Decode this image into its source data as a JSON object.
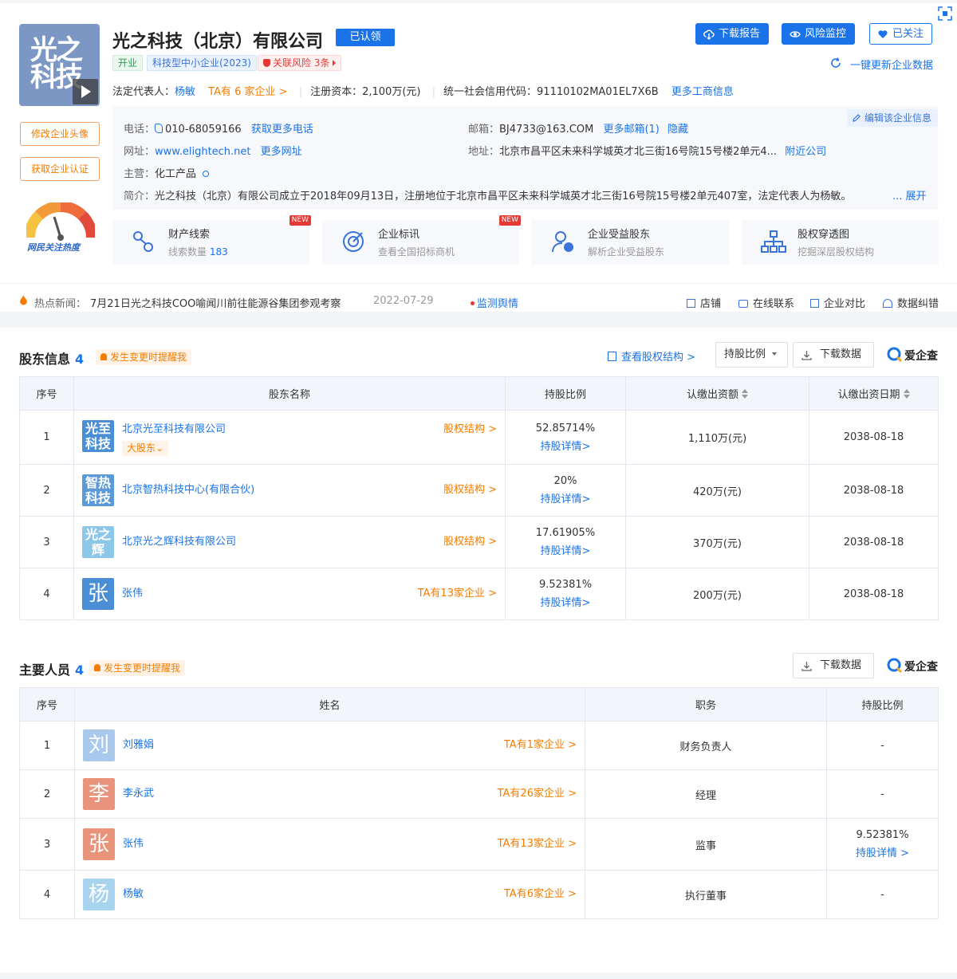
{
  "company": {
    "logo_text": "光之科技",
    "name": "光之科技（北京）有限公司",
    "claimed": "已认领",
    "tags": {
      "status": "开业",
      "sme": "科技型中小企业(2023)",
      "risk": "关联风险 3条"
    },
    "buttons": {
      "download": "下载报告",
      "monitor": "风险监控",
      "follow": "已关注"
    },
    "refresh": "一键更新企业数据",
    "legal_rep_label": "法定代表人：",
    "legal_rep": "杨敏",
    "legal_rep_companies": "TA有 6 家企业 >",
    "capital_label": "注册资本：",
    "capital": "2,100万(元)",
    "credit_code_label": "统一社会信用代码：",
    "credit_code": "91110102MA01EL7X6B",
    "more_business_info": "更多工商信息",
    "side_buttons": {
      "edit_avatar": "修改企业头像",
      "get_cert": "获取企业认证"
    },
    "heat_label": "网民关注热度"
  },
  "info": {
    "edit": "编辑该企业信息",
    "phone_label": "电话：",
    "phone": "010-68059166",
    "more_phone": "获取更多电话",
    "email_label": "邮箱：",
    "email": "BJ4733@163.COM",
    "more_email": "更多邮箱(1)",
    "hide": "隐藏",
    "website_label": "网址：",
    "website": "www.elightech.net",
    "more_website": "更多网址",
    "address_label": "地址：",
    "address": "北京市昌平区未来科学城英才北三街16号院15号楼2单元4...",
    "nearby": "附近公司",
    "business_label": "主营：",
    "business": "化工产品",
    "intro_label": "简介：",
    "intro": "光之科技（北京）有限公司成立于2018年09月13日，注册地位于北京市昌平区未来科学城英才北三街16号院15号楼2单元407室，法定代表人为杨敏。",
    "expand": "... 展开"
  },
  "features": [
    {
      "title": "财产线索",
      "sub_label": "线索数量",
      "sub_value": "183",
      "badge": "NEW"
    },
    {
      "title": "企业标讯",
      "sub_label": "查看全国招标商机",
      "sub_value": "",
      "badge": "NEW"
    },
    {
      "title": "企业受益股东",
      "sub_label": "解析企业受益股东",
      "sub_value": "",
      "badge": ""
    },
    {
      "title": "股权穿透图",
      "sub_label": "挖掘深层股权结构",
      "sub_value": "",
      "badge": ""
    }
  ],
  "news": {
    "label": "热点新闻：",
    "text": "7月21日光之科技COO喻闻川前往能源谷集团参观考察",
    "date": "2022-07-29",
    "monitor": "监测舆情",
    "links": [
      "店铺",
      "在线联系",
      "企业对比",
      "数据纠错"
    ]
  },
  "shareholders": {
    "title": "股东信息",
    "count": "4",
    "remind": "发生变更时提醒我",
    "view_structure": "查看股权结构 >",
    "sort_select": "持股比例",
    "download": "下载数据",
    "brand": "爱企查",
    "columns": [
      "序号",
      "股东名称",
      "持股比例",
      "认缴出资额",
      "认缴出资日期"
    ],
    "rows": [
      {
        "no": "1",
        "avatar": "光至科技",
        "name": "北京光至科技有限公司",
        "link": "股权结构 >",
        "badge": "大股东",
        "ratio": "52.85714%",
        "detail": "持股详情>",
        "amount": "1,110万(元)",
        "date": "2038-08-18",
        "color": "#4a8fd6"
      },
      {
        "no": "2",
        "avatar": "智热科技",
        "name": "北京智热科技中心(有限合伙)",
        "link": "股权结构 >",
        "badge": "",
        "ratio": "20%",
        "detail": "持股详情>",
        "amount": "420万(元)",
        "date": "2038-08-18",
        "color": "#5b9ad9"
      },
      {
        "no": "3",
        "avatar": "光之辉",
        "name": "北京光之辉科技有限公司",
        "link": "股权结构 >",
        "badge": "",
        "ratio": "17.61905%",
        "detail": "持股详情>",
        "amount": "370万(元)",
        "date": "2038-08-18",
        "color": "#8cc7ea"
      },
      {
        "no": "4",
        "avatar": "张",
        "name": "张伟",
        "link": "TA有13家企业 >",
        "badge": "",
        "ratio": "9.52381%",
        "detail": "持股详情>",
        "amount": "200万(元)",
        "date": "2038-08-18",
        "color": "#4a8fd6"
      }
    ]
  },
  "personnel": {
    "title": "主要人员",
    "count": "4",
    "remind": "发生变更时提醒我",
    "download": "下载数据",
    "brand": "爱企查",
    "columns": [
      "序号",
      "姓名",
      "职务",
      "持股比例"
    ],
    "rows": [
      {
        "no": "1",
        "avatar": "刘",
        "name": "刘雅娟",
        "link": "TA有1家企业 >",
        "role": "财务负责人",
        "ratio": "-",
        "detail": "",
        "color": "#a8c8ee"
      },
      {
        "no": "2",
        "avatar": "李",
        "name": "李永武",
        "link": "TA有26家企业 >",
        "role": "经理",
        "ratio": "-",
        "detail": "",
        "color": "#e8937a"
      },
      {
        "no": "3",
        "avatar": "张",
        "name": "张伟",
        "link": "TA有13家企业 >",
        "role": "监事",
        "ratio": "9.52381%",
        "detail": "持股详情 >",
        "color": "#e8937a"
      },
      {
        "no": "4",
        "avatar": "杨",
        "name": "杨敏",
        "link": "TA有6家企业 >",
        "role": "执行董事",
        "ratio": "-",
        "detail": "",
        "color": "#a8d3ee"
      }
    ]
  }
}
